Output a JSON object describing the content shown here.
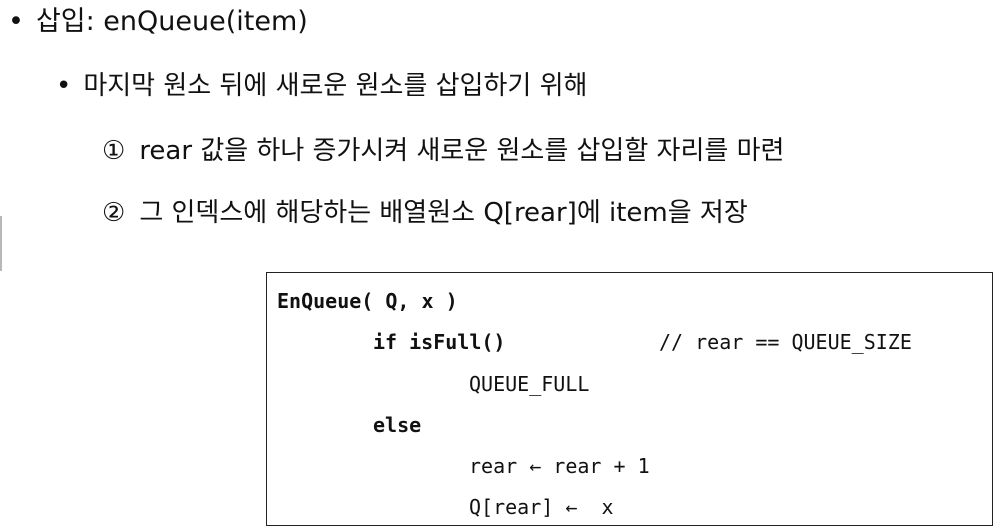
{
  "slide": {
    "line1": {
      "bullet": "•",
      "text": "삽입: enQueue(item)"
    },
    "line2": {
      "bullet": "•",
      "text": "마지막 원소 뒤에 새로운 원소를 삽입하기 위해"
    },
    "line3": {
      "number": "①",
      "text": "rear 값을 하나 증가시켜 새로운 원소를 삽입할 자리를 마련"
    },
    "line4": {
      "number": "②",
      "text": "그 인덱스에 해당하는 배열원소 Q[rear]에 item을 저장"
    }
  },
  "code": {
    "line1": "EnQueue( Q, x )",
    "line2": "if isFull()",
    "line2_comment": "// rear == QUEUE_SIZE",
    "line3": "QUEUE_FULL",
    "line4": "else",
    "line5": "rear ← rear + 1",
    "line6": "Q[rear] ←  x"
  }
}
